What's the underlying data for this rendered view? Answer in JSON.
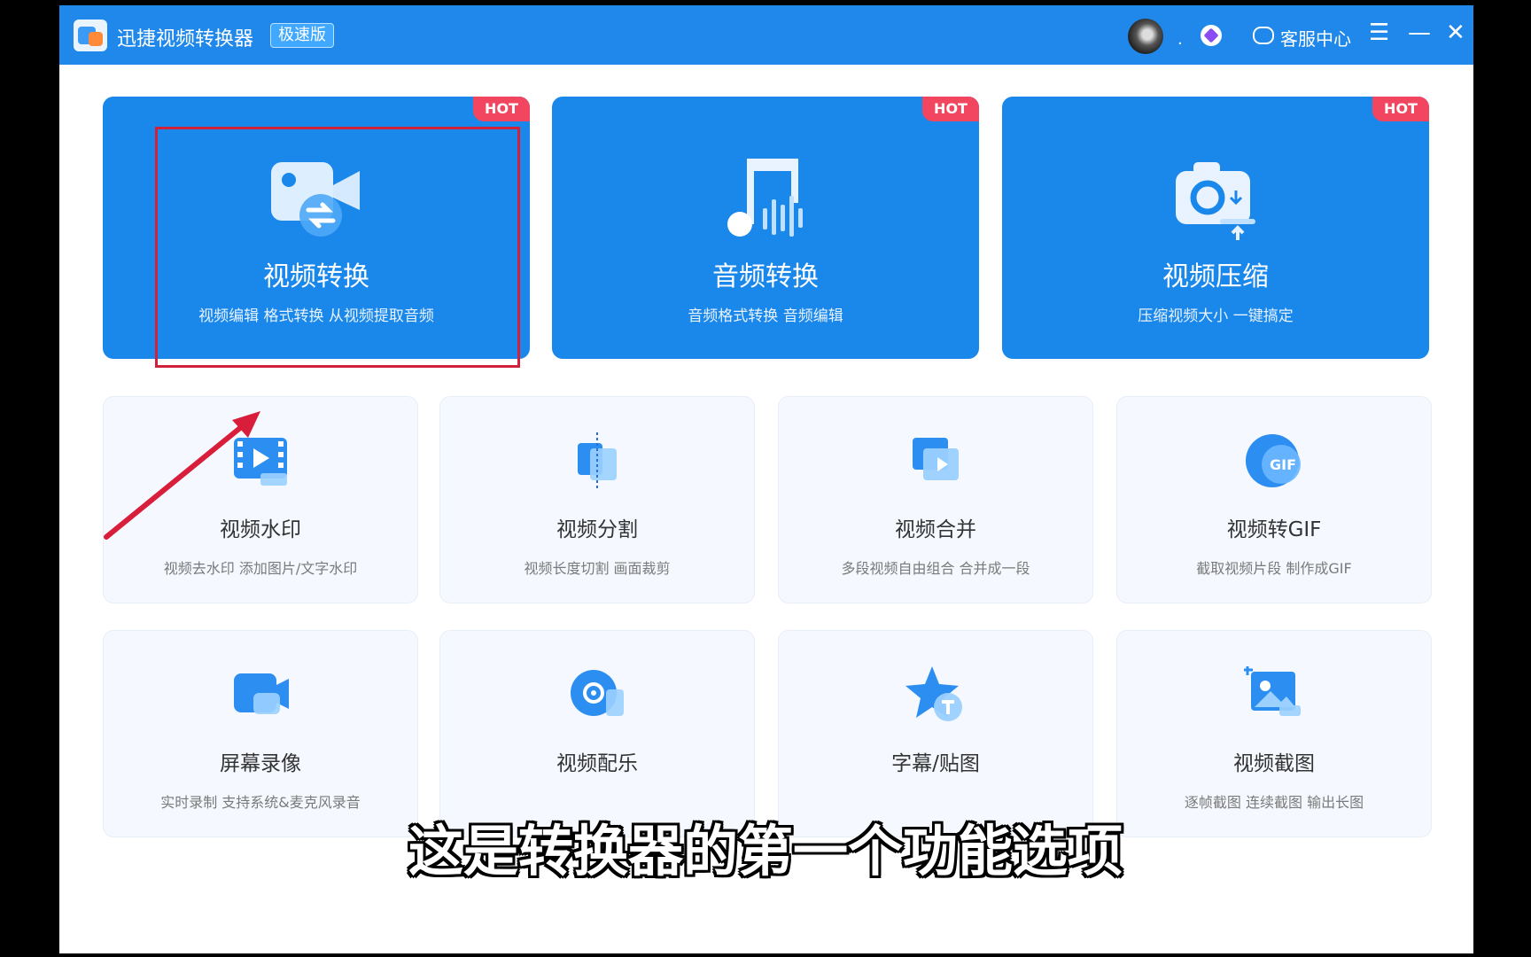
{
  "app": {
    "title": "迅捷视频转换器",
    "edition": "极速版",
    "avatar_dot": ".",
    "service_label": "客服中心",
    "menu_glyph": "☰",
    "min_glyph": "—",
    "close_glyph": "✕"
  },
  "hot_label": "HOT",
  "main_features": [
    {
      "title": "视频转换",
      "desc": "视频编辑 格式转换 从视频提取音频",
      "icon": "video-convert-icon"
    },
    {
      "title": "音频转换",
      "desc": "音频格式转换 音频编辑",
      "icon": "music-note-icon"
    },
    {
      "title": "视频压缩",
      "desc": "压缩视频大小 一键搞定",
      "icon": "camera-compress-icon"
    }
  ],
  "tools_row1": [
    {
      "title": "视频水印",
      "desc": "视频去水印 添加图片/文字水印",
      "icon": "watermark-icon"
    },
    {
      "title": "视频分割",
      "desc": "视频长度切割 画面裁剪",
      "icon": "split-icon"
    },
    {
      "title": "视频合并",
      "desc": "多段视频自由组合 合并成一段",
      "icon": "merge-icon"
    },
    {
      "title": "视频转GIF",
      "desc": "截取视频片段 制作成GIF",
      "icon": "gif-icon",
      "icon_text": "GIF"
    }
  ],
  "tools_row2": [
    {
      "title": "屏幕录像",
      "desc": "实时录制 支持系统&麦克风录音",
      "icon": "screen-record-icon"
    },
    {
      "title": "视频配乐",
      "desc": "",
      "icon": "music-disc-icon"
    },
    {
      "title": "字幕/贴图",
      "desc": "",
      "icon": "star-text-icon"
    },
    {
      "title": "视频截图",
      "desc": "逐帧截图 连续截图 输出长图",
      "icon": "screenshot-icon"
    }
  ],
  "caption": "这是转换器的第一个功能选项",
  "colors": {
    "titlebar": "#1f88ea",
    "big_card": "#1a87ea",
    "hot": "#f2455f",
    "highlight": "#d1203a"
  }
}
